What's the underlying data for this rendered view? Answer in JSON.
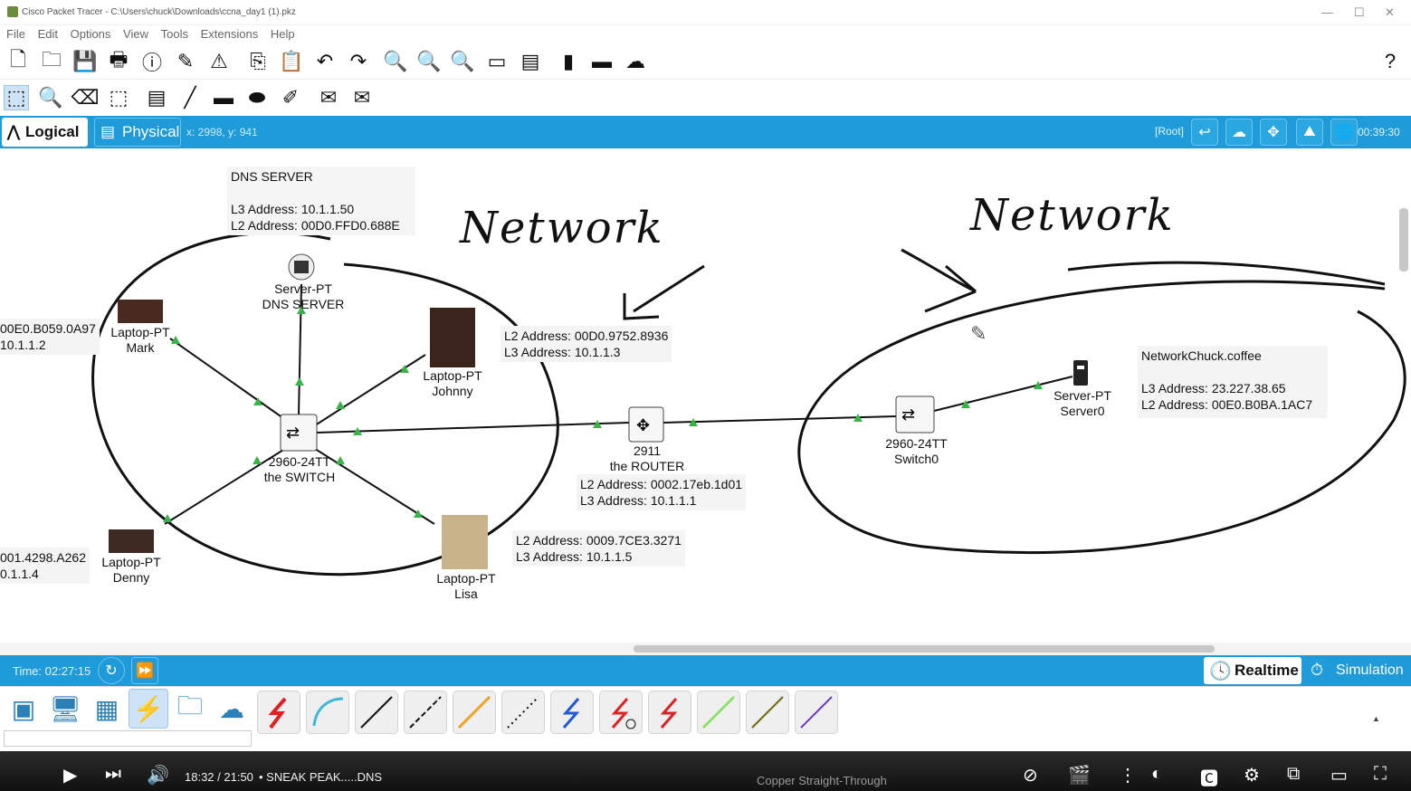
{
  "window": {
    "title": "Cisco Packet Tracer - C:\\Users\\chuck\\Downloads\\ccna_day1 (1).pkz"
  },
  "menu": [
    "File",
    "Edit",
    "Options",
    "View",
    "Tools",
    "Extensions",
    "Help"
  ],
  "toolbar1_icons": [
    "new-file",
    "open-folder",
    "save",
    "print",
    "info",
    "activity-wizard",
    "network-info",
    "copy",
    "paste",
    "undo",
    "redo",
    "zoom-in",
    "zoom-reset",
    "zoom-out",
    "drawing-palette",
    "custom-device",
    "palette",
    "cluster",
    "viewport"
  ],
  "toolbar2_icons": [
    "select",
    "inspect",
    "delete",
    "resize",
    "note",
    "draw-line",
    "draw-rectangle",
    "draw-ellipse",
    "freeform",
    "simple-pdu",
    "complex-pdu"
  ],
  "logicbar": {
    "logical": "Logical",
    "physical": "Physical",
    "coords": "x: 2998, y: 941",
    "root": "[Root]",
    "clock": "00:39:30"
  },
  "canvas": {
    "dns_box": {
      "title": "DNS SERVER",
      "l3": "L3 Address: 10.1.1.50",
      "l2": "L2 Address: 00D0.FFD0.688E"
    },
    "hand_left": "Network",
    "hand_right": "Network",
    "devices": [
      {
        "type": "Server-PT",
        "name": "DNS SERVER"
      },
      {
        "type": "Laptop-PT",
        "name": "Mark"
      },
      {
        "type": "Laptop-PT",
        "name": "Johnny"
      },
      {
        "type": "2960-24TT",
        "name": "the SWITCH"
      },
      {
        "type": "Laptop-PT",
        "name": "Denny"
      },
      {
        "type": "Laptop-PT",
        "name": "Lisa"
      },
      {
        "type": "2911",
        "name": "the ROUTER"
      },
      {
        "type": "2960-24TT",
        "name": "Switch0"
      },
      {
        "type": "Server-PT",
        "name": "Server0"
      }
    ],
    "mark_addr": {
      "l2": "00E0.B059.0A97",
      "l3": "10.1.1.2"
    },
    "denny_addr": {
      "l2": "001.4298.A262",
      "l3": "0.1.1.4"
    },
    "johnny_addr": {
      "l2": "L2 Address: 00D0.9752.8936",
      "l3": "L3 Address: 10.1.1.3"
    },
    "lisa_addr": {
      "l2": "L2 Address: 0009.7CE3.3271",
      "l3": "L3 Address: 10.1.1.5"
    },
    "router_addr": {
      "l2": "L2 Address: 0002.17eb.1d01",
      "l3": "L3 Address: 10.1.1.1"
    },
    "remote_server": {
      "title": "NetworkChuck.coffee",
      "l3": "L3 Address: 23.227.38.65",
      "l2": "L2 Address: 00E0.B0BA.1AC7"
    }
  },
  "timebar": {
    "time": "Time: 02:27:15",
    "realtime": "Realtime",
    "simulation": "Simulation"
  },
  "status": {
    "cable_name": "Copper Straight-Through"
  },
  "video": {
    "elapsed": "18:32 / 21:50",
    "chapter": "• SNEAK PEAK.....DNS",
    "progress_fraction": 0.847
  }
}
